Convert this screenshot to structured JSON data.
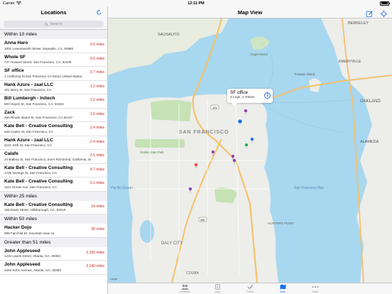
{
  "status": {
    "carrier": "Carrier",
    "time": "12:11 PM",
    "battery_pct": 100
  },
  "sidebar": {
    "title": "Locations",
    "search_placeholder": "Search",
    "sections": [
      {
        "header": "Within 10 miles",
        "rows": [
          {
            "name": "Anna Haro",
            "address": "1001 Leavenworth Street, Sausalito, CA, 94965",
            "distance": "0.5 miles"
          },
          {
            "name": "Whole SF",
            "address": "747 Howard Street, San Francisco, CA, 94109",
            "distance": "0.5 miles"
          },
          {
            "name": "SF office",
            "address": "1 California St San Francisco CA 94111 United States",
            "distance": "0.7 miles"
          },
          {
            "name": "Hank Azure - zaal LLC",
            "address": "201 Berry St, San Francisco, CA",
            "distance": "1.2 miles"
          },
          {
            "name": "Bill Lumbergh - Initech",
            "address": "500 Hayes St, San Francisco, CA, 94102",
            "distance": "1.2 miles"
          },
          {
            "name": "Zack",
            "address": "450 Rhode Island St, San Francisco, CA 94107",
            "distance": "1.6 miles"
          },
          {
            "name": "Kate Bell - Creative Consulting",
            "address": "549 Castro St, San Francisco, CA",
            "distance": "2.4 miles"
          },
          {
            "name": "Hank Azure - zaal LLC",
            "address": "3101 24th St, San Francisco, CA",
            "distance": "2.4 miles"
          },
          {
            "name": "Calafe",
            "address": "24 Balboa St, San Francisco, Inner Richmond, California, San Francisco, CA",
            "distance": "2.5 miles"
          },
          {
            "name": "Kate Bell - Creative Consulting",
            "address": "1735 Noriega St, San Francisco, CA",
            "distance": "4.7 miles"
          },
          {
            "name": "Kate Bell - Creative Consulting",
            "address": "1110 Ocean Ave, San Francisco, CA",
            "distance": "5.1 miles"
          }
        ]
      },
      {
        "header": "Within 25 miles",
        "rows": [
          {
            "name": "Kate Bell - Creative Consulting",
            "address": "165 Davis Street, Hillsborough, CA, 94010",
            "distance": "14 miles"
          }
        ]
      },
      {
        "header": "Within 50 miles",
        "rows": [
          {
            "name": "Hacker Dojo",
            "address": "599 Fairchild Dr, mountain view ca",
            "distance": "30 miles"
          }
        ]
      },
      {
        "header": "Greater than 51 miles",
        "rows": [
          {
            "name": "John Appleseed",
            "address": "1234 Laurel Street, Atlanta, GA, 30303",
            "distance": "2,156 miles"
          },
          {
            "name": "John Appleseed",
            "address": "3494 Kuhn Avenue, Atlanta, GA, 30303",
            "distance": "2,140 miles"
          }
        ]
      }
    ]
  },
  "main": {
    "title": "Map View",
    "callout": {
      "title": "SF office",
      "subtitle": "3 Logs, 2 ToDos"
    },
    "legal": "Legal",
    "map_labels": {
      "sausalito": "SAUSALITO",
      "berkeley": "BERKELEY",
      "emeryville": "EMERYVILLE",
      "oakland": "OAKLAND",
      "alameda": "ALAMEDA",
      "san_francisco": "SAN FRANCISCO",
      "daly_city": "DALY CITY",
      "colma": "COLMA",
      "angel_island": "Angel Island",
      "golden_gate_park": "Golden Gate Park",
      "treasure_island": "Treasure Island",
      "hunters_point": "HUNTERS POINT",
      "sf_bay": "San Francisco Bay",
      "ocean": "Pacific Ocean"
    },
    "pins": [
      {
        "kind": "pin",
        "color": "#8e44ad"
      },
      {
        "kind": "pin",
        "color": "#e74c3c"
      },
      {
        "kind": "pin",
        "color": "#8e44ad"
      },
      {
        "kind": "pin",
        "color": "#8e44ad"
      },
      {
        "kind": "pin",
        "color": "#8e44ad"
      },
      {
        "kind": "pin",
        "color": "#27ae60"
      },
      {
        "kind": "pin",
        "color": "#1a73e8"
      },
      {
        "kind": "pin",
        "color": "#8e44ad"
      },
      {
        "kind": "pin",
        "color": "#e74c3c"
      },
      {
        "kind": "pin",
        "color": "#8e44ad"
      }
    ]
  },
  "tabs": [
    {
      "label": "Contacts",
      "icon": "contacts-icon",
      "active": false
    },
    {
      "label": "Logs",
      "icon": "logs-icon",
      "active": false
    },
    {
      "label": "ToDos",
      "icon": "checkmark-icon",
      "active": false
    },
    {
      "label": "Map",
      "icon": "map-icon",
      "active": true
    },
    {
      "label": "More",
      "icon": "more-icon",
      "active": false
    }
  ],
  "colors": {
    "accent": "#1a73e8",
    "distance": "#c8241c",
    "water": "#a8d7f0",
    "land": "#ededea"
  }
}
